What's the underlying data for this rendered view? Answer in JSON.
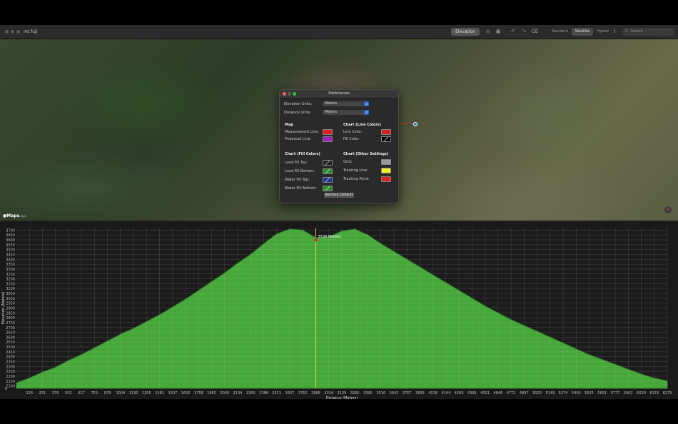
{
  "window": {
    "title": "mt fuji",
    "elevation_button": "Elevation",
    "map_modes": [
      "Standard",
      "Satellite",
      "Hybrid"
    ],
    "active_map_mode": "Satellite",
    "search_placeholder": "Search"
  },
  "map": {
    "brand": "Maps",
    "legal": "Legal",
    "compass_label": "N"
  },
  "preferences": {
    "title": "Preferences",
    "elevation_units_label": "Elevation Units:",
    "elevation_units_value": "Meters",
    "distance_units_label": "Distance Units:",
    "distance_units_value": "Meters",
    "map_section": {
      "header": "Map",
      "measurement_line_label": "Measurement Line:",
      "projected_line_label": "Projected Line:"
    },
    "chart_line_section": {
      "header": "Chart (Line Colors)",
      "line_color_label": "Line Color:",
      "fill_color_label": "Fill Color:"
    },
    "chart_fill_section": {
      "header": "Chart (Fill Colors)",
      "land_fill_top_label": "Land Fill Top:",
      "land_fill_bottom_label": "Land Fill Bottom:",
      "water_fill_top_label": "Water Fill Top:",
      "water_fill_bottom_label": "Water Fill Bottom:"
    },
    "chart_other_section": {
      "header": "Chart (Other Settings)",
      "grid_label": "Grid:",
      "tracking_line_label": "Tracking Line:",
      "tracking_point_label": "Tracking Point:"
    },
    "restore_button": "Restore Default",
    "colors": {
      "measurement_line": "#e02020",
      "projected_line": "#a020c0",
      "line_color": "#e02020",
      "grid": "#9a9a9a",
      "tracking_line": "#f0f020",
      "tracking_point": "#e02020"
    }
  },
  "chart_data": {
    "type": "area",
    "ylabel": "Elevation (Meters)",
    "xlabel": "Distance (Meters)",
    "y_ticks": [
      0,
      2100,
      2150,
      2200,
      2250,
      2300,
      2350,
      2400,
      2450,
      2500,
      2550,
      2600,
      2650,
      2700,
      2750,
      2800,
      2850,
      2900,
      2950,
      3000,
      3050,
      3100,
      3150,
      3200,
      3250,
      3300,
      3350,
      3400,
      3450,
      3500,
      3550,
      3600,
      3650,
      3700
    ],
    "x_ticks": [
      0,
      126,
      251,
      376,
      502,
      627,
      753,
      879,
      1004,
      1130,
      1255,
      1381,
      1507,
      1632,
      1758,
      1883,
      2009,
      2134,
      2260,
      2386,
      2511,
      2637,
      2762,
      2888,
      3014,
      3139,
      3265,
      3390,
      3516,
      3642,
      3767,
      3893,
      4018,
      4144,
      4269,
      4395,
      4521,
      4646,
      4772,
      4897,
      5023,
      5149,
      5274,
      5400,
      5525,
      5651,
      5777,
      5902,
      6028,
      6153,
      6279
    ],
    "xlim": [
      0,
      6279
    ],
    "ylim": [
      2075,
      3725
    ],
    "fill_color": "#47a83a",
    "line_color": "#2c8a26",
    "series": [
      {
        "x": [
          0,
          126,
          251,
          376,
          502,
          627,
          753,
          879,
          1004,
          1130,
          1255,
          1381,
          1507,
          1632,
          1758,
          1883,
          2009,
          2134,
          2260,
          2386,
          2511,
          2637,
          2762,
          2888,
          3014,
          3139,
          3265,
          3390,
          3516,
          3642,
          3767,
          3893,
          4018,
          4144,
          4269,
          4395,
          4521,
          4646,
          4772,
          4897,
          5023,
          5149,
          5274,
          5400,
          5525,
          5651,
          5777,
          5902,
          6028,
          6153,
          6279
        ],
        "y": [
          2130,
          2180,
          2240,
          2290,
          2360,
          2420,
          2490,
          2560,
          2630,
          2690,
          2760,
          2830,
          2910,
          2990,
          3080,
          3170,
          3260,
          3360,
          3450,
          3560,
          3660,
          3710,
          3700,
          3620,
          3630,
          3690,
          3710,
          3650,
          3560,
          3480,
          3400,
          3320,
          3240,
          3160,
          3080,
          3000,
          2920,
          2850,
          2780,
          2720,
          2660,
          2600,
          2540,
          2480,
          2420,
          2370,
          2320,
          2270,
          2220,
          2180,
          2150
        ]
      }
    ],
    "tracking": {
      "x": 2888,
      "y": 3599,
      "label": "3599 Meters"
    },
    "grid": true
  }
}
